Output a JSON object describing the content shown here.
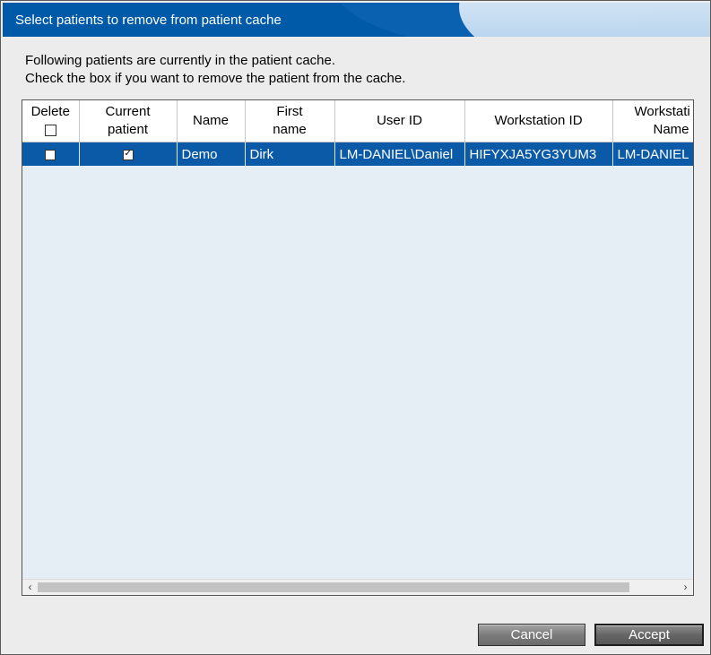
{
  "window": {
    "title": "Select patients to remove from patient cache"
  },
  "info": {
    "line1": "Following patients are currently in the patient cache.",
    "line2": "Check the box if you want to remove the patient from the cache."
  },
  "table": {
    "headers": [
      {
        "line1": "Delete",
        "line2": ""
      },
      {
        "line1": "Current",
        "line2": "patient"
      },
      {
        "line1": "Name",
        "line2": ""
      },
      {
        "line1": "First",
        "line2": "name"
      },
      {
        "line1": "User ID",
        "line2": ""
      },
      {
        "line1": "Workstation ID",
        "line2": ""
      },
      {
        "line1": "Workstati",
        "line2": "Name"
      }
    ],
    "header_delete_checkbox": {
      "checked": false
    },
    "rows": [
      {
        "delete": false,
        "current_patient": true,
        "name": "Demo",
        "first_name": "Dirk",
        "user_id": "LM-DANIEL\\Daniel",
        "workstation_id": "HIFYXJA5YG3YUM3",
        "workstation_name": "LM-DANIEL"
      }
    ]
  },
  "scrollbar": {
    "left_arrow": "‹",
    "right_arrow": "›"
  },
  "buttons": {
    "cancel": "Cancel",
    "accept": "Accept"
  },
  "colors": {
    "title_bar": "#005aa8",
    "selected_row": "#0a5aa8",
    "grid_background": "#e6eef5"
  }
}
